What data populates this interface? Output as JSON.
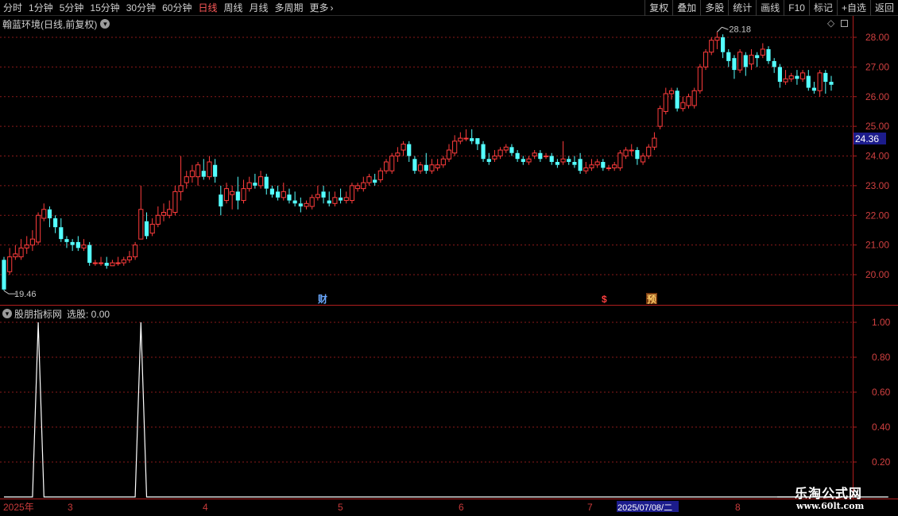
{
  "toolbar": {
    "periods": [
      "分时",
      "1分钟",
      "5分钟",
      "15分钟",
      "30分钟",
      "60分钟",
      "日线",
      "周线",
      "月线",
      "多周期",
      "更多"
    ],
    "active_period": "日线",
    "actions": [
      "复权",
      "叠加",
      "多股",
      "统计",
      "画线",
      "F10",
      "标记",
      "+自选",
      "返回"
    ]
  },
  "main_chart": {
    "title": "翰蓝环境(日线,前复权)",
    "y_ticks": [
      "28.00",
      "27.00",
      "26.00",
      "25.00",
      "24.00",
      "23.00",
      "22.00",
      "21.00",
      "20.00"
    ],
    "y_tick_values": [
      28,
      27,
      26,
      25,
      24,
      23,
      22,
      21,
      20
    ],
    "current_price_label": "24.36",
    "high_label": "28.18",
    "low_label": "19.46",
    "event_markers": [
      "财",
      "$",
      "预"
    ],
    "colors": {
      "up": "#ff3c3c",
      "down": "#54ffff",
      "grid": "#8a1a1a",
      "axis": "#b01e1e"
    }
  },
  "indicator": {
    "title": "股朋指标网",
    "value_label": "选股: 0.00",
    "y_ticks": [
      "1.00",
      "0.80",
      "0.60",
      "0.40",
      "0.20"
    ]
  },
  "time_axis": {
    "labels": [
      "2025年",
      "3",
      "4",
      "5",
      "6",
      "7",
      "2025/07/08/二",
      "8"
    ]
  },
  "watermark": {
    "title": "乐淘公式网",
    "url": "www.60lt.com"
  },
  "chart_data": {
    "type": "candlestick",
    "y_unit": "price",
    "ylim": [
      19.3,
      28.5
    ],
    "candles": [
      [
        20.5,
        19.5,
        20.6,
        19.46
      ],
      [
        20.1,
        20.6,
        20.9,
        20.0
      ],
      [
        20.6,
        20.7,
        21.0,
        20.5
      ],
      [
        20.6,
        20.9,
        21.2,
        20.5
      ],
      [
        20.9,
        21.0,
        21.3,
        20.7
      ],
      [
        21.0,
        21.2,
        21.5,
        20.8
      ],
      [
        21.1,
        22.0,
        22.1,
        21.0
      ],
      [
        21.9,
        22.2,
        22.4,
        21.8
      ],
      [
        22.2,
        21.9,
        22.3,
        21.6
      ],
      [
        21.9,
        21.6,
        22.0,
        21.4
      ],
      [
        21.6,
        21.2,
        21.9,
        21.1
      ],
      [
        21.2,
        21.1,
        21.3,
        20.9
      ],
      [
        21.1,
        21.0,
        21.2,
        20.8
      ],
      [
        21.1,
        20.9,
        21.3,
        20.8
      ],
      [
        20.9,
        21.0,
        21.2,
        20.8
      ],
      [
        21.0,
        20.4,
        21.1,
        20.3
      ],
      [
        20.4,
        20.4,
        20.5,
        20.3
      ],
      [
        20.4,
        20.4,
        20.6,
        20.3
      ],
      [
        20.4,
        20.3,
        20.6,
        20.2
      ],
      [
        20.3,
        20.4,
        20.5,
        20.3
      ],
      [
        20.4,
        20.4,
        20.6,
        20.3
      ],
      [
        20.4,
        20.5,
        20.6,
        20.3
      ],
      [
        20.5,
        20.6,
        20.8,
        20.4
      ],
      [
        20.6,
        21.0,
        21.1,
        20.5
      ],
      [
        21.2,
        22.2,
        23.0,
        21.2
      ],
      [
        21.8,
        21.3,
        22.1,
        21.2
      ],
      [
        21.4,
        21.7,
        21.9,
        21.3
      ],
      [
        21.7,
        22.0,
        22.3,
        21.6
      ],
      [
        22.0,
        22.1,
        22.4,
        21.8
      ],
      [
        22.0,
        22.2,
        22.5,
        21.9
      ],
      [
        22.1,
        22.8,
        23.0,
        22.0
      ],
      [
        22.8,
        23.0,
        24.0,
        22.5
      ],
      [
        23.1,
        23.3,
        23.5,
        22.9
      ],
      [
        23.3,
        23.5,
        23.7,
        23.1
      ],
      [
        23.3,
        23.7,
        23.8,
        23.0
      ],
      [
        23.5,
        23.3,
        23.9,
        23.2
      ],
      [
        23.3,
        23.8,
        24.0,
        23.2
      ],
      [
        23.7,
        23.3,
        23.9,
        23.1
      ],
      [
        22.7,
        22.3,
        23.0,
        22.0
      ],
      [
        22.5,
        22.9,
        23.1,
        22.4
      ],
      [
        22.7,
        22.8,
        23.0,
        22.2
      ],
      [
        22.8,
        22.5,
        23.3,
        22.2
      ],
      [
        22.5,
        22.9,
        23.2,
        22.4
      ],
      [
        22.9,
        23.1,
        23.3,
        22.8
      ],
      [
        23.1,
        23.0,
        23.4,
        22.9
      ],
      [
        23.0,
        23.3,
        23.5,
        22.9
      ],
      [
        23.3,
        22.9,
        23.4,
        22.7
      ],
      [
        22.9,
        22.7,
        23.0,
        22.6
      ],
      [
        22.8,
        22.6,
        23.0,
        22.5
      ],
      [
        22.6,
        22.8,
        23.1,
        22.5
      ],
      [
        22.7,
        22.5,
        22.9,
        22.4
      ],
      [
        22.5,
        22.4,
        22.8,
        22.3
      ],
      [
        22.4,
        22.3,
        22.6,
        22.1
      ],
      [
        22.3,
        22.4,
        22.5,
        22.2
      ],
      [
        22.3,
        22.6,
        22.7,
        22.2
      ],
      [
        22.6,
        22.7,
        23.0,
        22.5
      ],
      [
        22.8,
        22.6,
        23.0,
        22.4
      ],
      [
        22.5,
        22.4,
        22.8,
        22.3
      ],
      [
        22.4,
        22.6,
        22.8,
        22.3
      ],
      [
        22.6,
        22.5,
        22.9,
        22.4
      ],
      [
        22.5,
        22.6,
        22.8,
        22.4
      ],
      [
        22.5,
        23.0,
        23.1,
        22.4
      ],
      [
        22.9,
        23.0,
        23.1,
        22.8
      ],
      [
        22.9,
        23.1,
        23.3,
        22.8
      ],
      [
        23.1,
        23.3,
        23.4,
        23.0
      ],
      [
        23.2,
        23.1,
        23.4,
        23.0
      ],
      [
        23.2,
        23.5,
        23.6,
        23.1
      ],
      [
        23.5,
        23.8,
        23.9,
        23.4
      ],
      [
        23.5,
        24.0,
        24.1,
        23.4
      ],
      [
        24.0,
        24.1,
        24.3,
        23.8
      ],
      [
        24.2,
        24.4,
        24.5,
        24.0
      ],
      [
        24.4,
        24.0,
        24.5,
        23.8
      ],
      [
        23.9,
        23.5,
        24.0,
        23.4
      ],
      [
        23.5,
        23.7,
        23.8,
        23.4
      ],
      [
        23.7,
        23.5,
        24.1,
        23.4
      ],
      [
        23.5,
        23.7,
        23.9,
        23.4
      ],
      [
        23.6,
        23.7,
        23.9,
        23.5
      ],
      [
        23.7,
        23.9,
        24.0,
        23.6
      ],
      [
        23.9,
        24.2,
        24.4,
        23.8
      ],
      [
        24.1,
        24.5,
        24.7,
        24.0
      ],
      [
        24.5,
        24.6,
        24.8,
        24.4
      ],
      [
        24.6,
        24.6,
        24.9,
        24.5
      ],
      [
        24.6,
        24.5,
        24.9,
        24.4
      ],
      [
        24.6,
        24.4,
        24.6,
        24.2
      ],
      [
        24.4,
        23.9,
        24.5,
        23.8
      ],
      [
        23.9,
        23.8,
        24.1,
        23.7
      ],
      [
        23.9,
        24.0,
        24.2,
        23.8
      ],
      [
        24.0,
        24.2,
        24.3,
        23.9
      ],
      [
        24.2,
        24.3,
        24.4,
        24.1
      ],
      [
        24.3,
        24.1,
        24.4,
        24.0
      ],
      [
        24.1,
        23.9,
        24.2,
        23.8
      ],
      [
        23.9,
        23.8,
        24.0,
        23.7
      ],
      [
        23.8,
        23.9,
        24.0,
        23.7
      ],
      [
        24.0,
        24.1,
        24.2,
        23.9
      ],
      [
        24.1,
        23.9,
        24.2,
        23.8
      ],
      [
        24.0,
        24.0,
        24.1,
        23.9
      ],
      [
        24.0,
        23.8,
        24.1,
        23.7
      ],
      [
        23.8,
        23.7,
        23.9,
        23.6
      ],
      [
        23.8,
        23.9,
        24.5,
        23.7
      ],
      [
        23.9,
        23.8,
        24.0,
        23.7
      ],
      [
        23.8,
        23.7,
        24.0,
        23.6
      ],
      [
        23.9,
        23.5,
        24.1,
        23.4
      ],
      [
        23.5,
        23.6,
        23.8,
        23.4
      ],
      [
        23.6,
        23.7,
        23.9,
        23.5
      ],
      [
        23.7,
        23.8,
        23.9,
        23.6
      ],
      [
        23.8,
        23.6,
        23.9,
        23.5
      ],
      [
        23.6,
        23.6,
        23.7,
        23.5
      ],
      [
        23.6,
        23.7,
        23.8,
        23.5
      ],
      [
        23.6,
        24.1,
        24.2,
        23.5
      ],
      [
        24.0,
        24.2,
        24.3,
        23.9
      ],
      [
        24.2,
        24.2,
        24.4,
        24.0
      ],
      [
        24.2,
        23.9,
        24.3,
        23.7
      ],
      [
        23.8,
        24.0,
        24.1,
        23.7
      ],
      [
        24.0,
        24.3,
        24.4,
        23.9
      ],
      [
        24.3,
        24.6,
        24.8,
        24.2
      ],
      [
        25.0,
        25.6,
        25.7,
        24.9
      ],
      [
        25.5,
        26.1,
        26.3,
        25.4
      ],
      [
        26.1,
        26.2,
        26.3,
        25.9
      ],
      [
        26.2,
        25.6,
        26.3,
        25.5
      ],
      [
        25.6,
        25.8,
        26.0,
        25.5
      ],
      [
        25.7,
        26.0,
        26.1,
        25.6
      ],
      [
        25.7,
        26.2,
        26.3,
        25.6
      ],
      [
        26.2,
        27.0,
        27.1,
        26.1
      ],
      [
        27.0,
        27.5,
        27.6,
        26.9
      ],
      [
        27.5,
        27.9,
        28.0,
        27.4
      ],
      [
        27.9,
        28.0,
        28.18,
        27.6
      ],
      [
        28.0,
        27.5,
        28.1,
        27.3
      ],
      [
        27.5,
        27.2,
        27.6,
        27.0
      ],
      [
        27.3,
        26.9,
        27.4,
        26.6
      ],
      [
        26.9,
        27.5,
        27.6,
        26.8
      ],
      [
        27.4,
        27.0,
        27.5,
        26.7
      ],
      [
        27.1,
        27.4,
        27.6,
        26.9
      ],
      [
        27.4,
        27.3,
        27.5,
        27.0
      ],
      [
        27.4,
        27.6,
        27.8,
        27.3
      ],
      [
        27.6,
        27.2,
        27.7,
        27.1
      ],
      [
        27.2,
        27.0,
        27.3,
        26.8
      ],
      [
        27.0,
        26.5,
        27.1,
        26.3
      ],
      [
        26.5,
        26.6,
        26.9,
        26.4
      ],
      [
        26.6,
        26.7,
        26.8,
        26.5
      ],
      [
        26.7,
        26.6,
        26.9,
        26.4
      ],
      [
        26.6,
        26.8,
        26.9,
        26.5
      ],
      [
        26.7,
        26.3,
        26.9,
        26.2
      ],
      [
        26.3,
        26.2,
        26.5,
        26.1
      ],
      [
        26.2,
        26.8,
        26.9,
        26.0
      ],
      [
        26.8,
        26.5,
        26.9,
        26.1
      ],
      [
        26.5,
        26.4,
        26.7,
        26.2
      ]
    ],
    "signal_series": [
      0,
      0,
      0,
      0,
      0,
      0,
      1,
      0,
      0,
      0,
      0,
      0,
      0,
      0,
      0,
      0,
      0,
      0,
      0,
      0,
      0,
      0,
      0,
      0,
      1,
      0,
      0,
      0,
      0,
      0,
      0,
      0,
      0,
      0,
      0,
      0,
      0,
      0,
      0,
      0,
      0,
      0,
      0,
      0,
      0,
      0,
      0,
      0,
      0,
      0,
      0,
      0,
      0,
      0,
      0,
      0,
      0,
      0,
      0,
      0,
      0,
      0,
      0,
      0,
      0,
      0,
      0,
      0,
      0,
      0,
      0,
      0,
      0,
      0,
      0,
      0,
      0,
      0,
      0,
      0,
      0,
      0,
      0,
      0,
      0,
      0,
      0,
      0,
      0,
      0,
      0,
      0,
      0,
      0,
      0,
      0,
      0,
      0,
      0,
      0,
      0,
      0,
      0,
      0,
      0,
      0,
      0,
      0,
      0,
      0,
      0,
      0,
      0,
      0,
      0,
      0,
      0,
      0,
      0,
      0,
      0,
      0,
      0,
      0,
      0,
      0,
      0,
      0,
      0,
      0,
      0,
      0,
      0,
      0,
      0,
      0,
      0,
      0,
      0,
      0,
      0,
      0,
      0,
      0,
      0,
      0,
      0,
      0,
      0,
      0,
      0,
      0,
      0,
      0,
      0,
      0
    ],
    "indicator_ylim": [
      0,
      1.1
    ]
  }
}
